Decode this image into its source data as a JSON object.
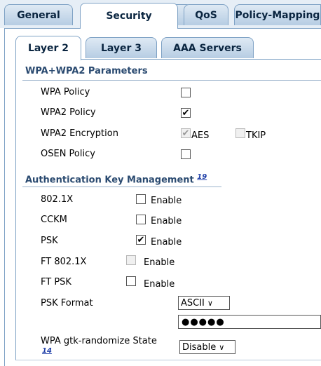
{
  "tabs": [
    "General",
    "Security",
    "QoS",
    "Policy-Mapping"
  ],
  "subtabs": [
    "Layer 2",
    "Layer 3",
    "AAA Servers"
  ],
  "wpa_section": {
    "title": "WPA+WPA2 Parameters",
    "wpa_policy": {
      "label": "WPA Policy",
      "checked": false
    },
    "wpa2_policy": {
      "label": "WPA2 Policy",
      "checked": true
    },
    "wpa2_encryption": {
      "label": "WPA2 Encryption",
      "aes": "AES",
      "tkip": "TKIP"
    },
    "osen_policy": {
      "label": "OSEN Policy",
      "checked": false
    }
  },
  "akm_section": {
    "title": "Authentication Key Management",
    "footnote": "19",
    "rows": [
      {
        "label": "802.1X",
        "option": "Enable",
        "checked": false,
        "disabled": false
      },
      {
        "label": "CCKM",
        "option": "Enable",
        "checked": false,
        "disabled": false
      },
      {
        "label": "PSK",
        "option": "Enable",
        "checked": true,
        "disabled": false
      },
      {
        "label": "FT 802.1X",
        "option": "Enable",
        "checked": false,
        "disabled": true
      },
      {
        "label": "FT PSK",
        "option": "Enable",
        "checked": false,
        "disabled": false
      }
    ],
    "psk_format": {
      "label": "PSK Format",
      "value": "ASCII"
    },
    "psk_key": "●●●●●",
    "gtk": {
      "label": "WPA gtk-randomize State",
      "footnote": "14",
      "value": "Disable"
    }
  },
  "colors": {
    "tab_border": "#7fa2c5",
    "section_title": "#2a4a70",
    "link": "#1f3fa8"
  }
}
